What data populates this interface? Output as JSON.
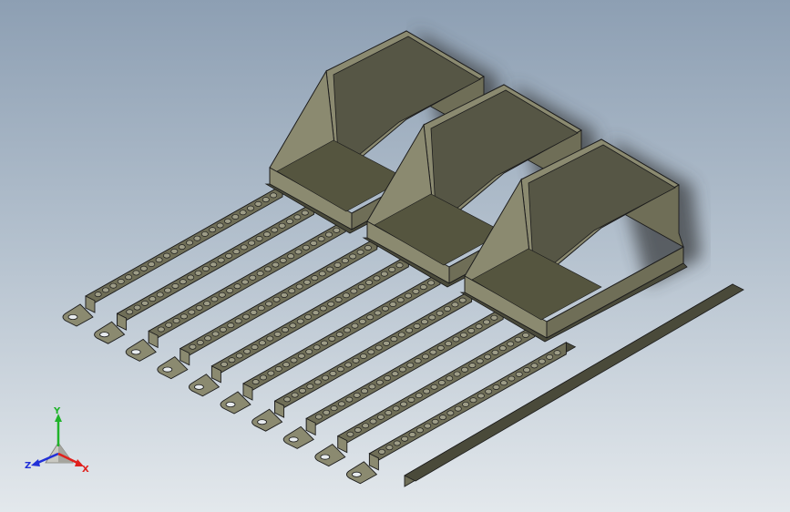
{
  "viewport": {
    "scene": "roller-rack-assembly",
    "colors": {
      "metal_light": "#8b8a70",
      "metal_mid": "#6f6e57",
      "metal_dark": "#4a4a3a",
      "edge": "#1c1c1c",
      "roller": "#9d9c86",
      "shadow": "#3a3d40"
    }
  },
  "triad": {
    "labels": {
      "y": "Y",
      "z": "Z",
      "x": "X"
    },
    "colors": {
      "x": "#e0201c",
      "y": "#1fb32a",
      "z": "#2130d8"
    }
  }
}
